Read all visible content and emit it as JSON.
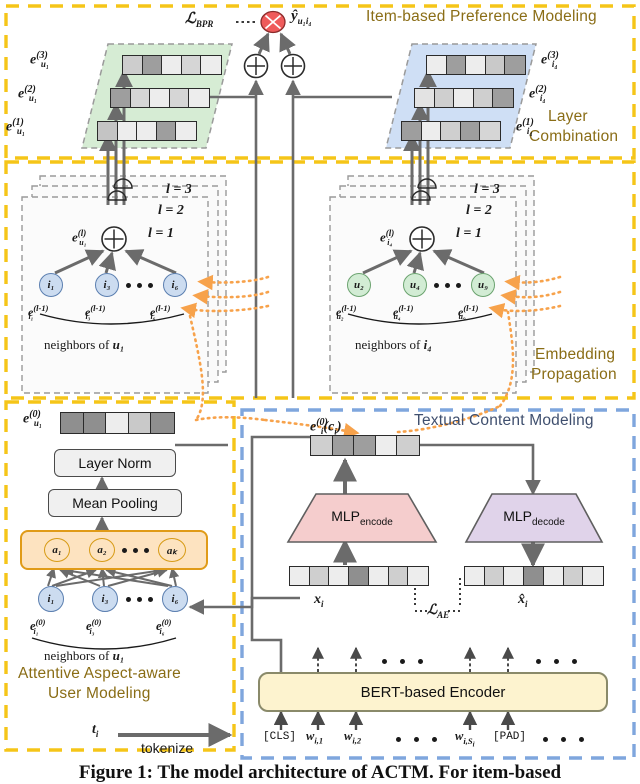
{
  "figure": {
    "caption": "Figure 1: The model architecture of ACTM. For item-based"
  },
  "sections": [
    {
      "id": "item-based-preference-modeling",
      "label": "Item-based Preference Modeling",
      "color": "#8a6d16"
    },
    {
      "id": "layer-combination",
      "label_line1": "Layer",
      "label_line2": "Combination",
      "color": "#8a6d16"
    },
    {
      "id": "embedding-propagation",
      "label_line1": "Embedding",
      "label_line2": "Propagation",
      "color": "#8a6d16"
    },
    {
      "id": "attentive-aspect-aware-user-modeling",
      "label_line1": "Attentive Aspect-aware",
      "label_line2": "User Modeling",
      "color": "#8a6d16"
    },
    {
      "id": "textual-content-modeling",
      "label": "Textual Content Modeling",
      "color": "#3f4f6e"
    }
  ],
  "top": {
    "bpr_loss": "ℒ",
    "bpr_loss_sub": "BPR",
    "prediction": "ŷ",
    "prediction_sub": "u₁i₄",
    "multiply_symbol": "⊗",
    "plus_symbol": "⊕",
    "multiply_color": "#ef5b5b"
  },
  "layer_combination": {
    "user_panel_color": "#d6ecd4",
    "item_panel_color": "#cfdff5",
    "user_labels": [
      {
        "base": "e",
        "sub": "u₁",
        "sup": "(3)"
      },
      {
        "base": "e",
        "sub": "u₁",
        "sup": "(2)"
      },
      {
        "base": "e",
        "sub": "u₁",
        "sup": "(1)"
      }
    ],
    "item_labels": [
      {
        "base": "e",
        "sub": "i₄",
        "sup": "(3)"
      },
      {
        "base": "e",
        "sub": "i₄",
        "sup": "(2)"
      },
      {
        "base": "e",
        "sub": "i₄",
        "sup": "(1)"
      }
    ],
    "user_vectors": [
      [
        "#cdcdcd",
        "#9e9e9e",
        "#ededed",
        "#d6d6d6",
        "#ededed"
      ],
      [
        "#9e9e9e",
        "#d6d6d6",
        "#ededed",
        "#d6d6d6",
        "#ededed"
      ],
      [
        "#c4c4c4",
        "#ededed",
        "#ededed",
        "#9e9e9e",
        "#ededed"
      ]
    ],
    "item_vectors": [
      [
        "#ededed",
        "#9e9e9e",
        "#ededed",
        "#c9c9c9",
        "#9e9e9e"
      ],
      [
        "#e3e3e3",
        "#cfcfcf",
        "#ededed",
        "#cfcfcf",
        "#9e9e9e"
      ],
      [
        "#9e9e9e",
        "#ededed",
        "#cfcfcf",
        "#9e9e9e",
        "#d6d6d6"
      ]
    ]
  },
  "propagation": {
    "user": {
      "layer_tags": [
        "l = 3",
        "l = 2",
        "l = 1"
      ],
      "center": {
        "base": "e",
        "sub": "u₁",
        "sup": "(l)"
      },
      "aggregator": "⊕",
      "neighbor_nodes": [
        "i₁",
        "i₃",
        "i₆"
      ],
      "neighbor_embeddings": [
        {
          "base": "e",
          "sub": "i₁",
          "sup": "(l-1)"
        },
        {
          "base": "e",
          "sub": "i₃",
          "sup": "(l-1)"
        },
        {
          "base": "e",
          "sub": "i₆",
          "sup": "(l-1)"
        }
      ],
      "brace_label": "neighbors of",
      "brace_label_math": "u₁"
    },
    "item": {
      "layer_tags": [
        "l = 3",
        "l = 2",
        "l = 1"
      ],
      "center": {
        "base": "e",
        "sub": "i₄",
        "sup": "(l)"
      },
      "aggregator": "⊕",
      "neighbor_nodes": [
        "u₂",
        "u₄",
        "u₉"
      ],
      "neighbor_embeddings": [
        {
          "base": "e",
          "sub": "u₂",
          "sup": "(l-1)"
        },
        {
          "base": "e",
          "sub": "u₄",
          "sup": "(l-1)"
        },
        {
          "base": "e",
          "sub": "u₉",
          "sup": "(l-1)"
        }
      ],
      "brace_label": "neighbors of",
      "brace_label_math": "i₄"
    }
  },
  "user_modeling": {
    "output_label": {
      "base": "e",
      "sub": "u₁",
      "sup": "(0)"
    },
    "output_vector": [
      "#8f8f8f",
      "#8f8f8f",
      "#ededed",
      "#c9c9c9",
      "#8f8f8f"
    ],
    "blocks": [
      "Layer Norm",
      "Mean Pooling"
    ],
    "aspect_nodes": [
      "a₁",
      "a₂",
      "aₖ"
    ],
    "aspect_box_fill": "#fde3c0",
    "aspect_box_border": "#e09b18",
    "item_nodes": [
      "i₁",
      "i₃",
      "i₆"
    ],
    "item_embeddings": [
      {
        "base": "e",
        "sub": "i₁",
        "sup": "(0)"
      },
      {
        "base": "e",
        "sub": "i₃",
        "sup": "(0)"
      },
      {
        "base": "e",
        "sub": "i₆",
        "sup": "(0)"
      }
    ],
    "brace_label": "neighbors of",
    "brace_label_math": "u₁"
  },
  "textual": {
    "content_label": {
      "base": "e",
      "sub": "i",
      "sup": "(0)",
      "paren": "(c",
      "paren_sub": "i",
      "paren_close": ")"
    },
    "content_vector": [
      "#cfcfcf",
      "#9e9e9e",
      "#9e9e9e",
      "#ededed",
      "#cfcfcf"
    ],
    "encoder_block": {
      "label": "MLP",
      "subscript": "encode",
      "fill": "#f5cdcd",
      "border": "#6e6e6e"
    },
    "decoder_block": {
      "label": "MLP",
      "subscript": "decode",
      "fill": "#e0d3ea",
      "border": "#6e6e6e"
    },
    "input_vector": [
      "#ededed",
      "#cfcfcf",
      "#ededed",
      "#8f8f8f",
      "#ededed",
      "#cfcfcf",
      "#ededed"
    ],
    "output_vector": [
      "#ededed",
      "#cfcfcf",
      "#ededed",
      "#8f8f8f",
      "#ededed",
      "#cfcfcf",
      "#ededed"
    ],
    "input_label": "x",
    "input_label_sub": "i",
    "output_label": "x̂",
    "output_label_sub": "i",
    "ae_loss": "ℒ",
    "ae_loss_sub": "AE",
    "bert_block": {
      "label": "BERT-based Encoder",
      "fill": "#fdf3cf",
      "border": "#8a8a6a"
    },
    "tokens": [
      "[CLS]",
      "w",
      "w",
      "• • •",
      "w",
      "[PAD]",
      "• • •"
    ],
    "token_display": [
      {
        "text": "[CLS]",
        "mono": true
      },
      {
        "text": "w",
        "sub": "i,1",
        "mono": false
      },
      {
        "text": "w",
        "sub": "i,2",
        "mono": false
      },
      {
        "text": "dots",
        "mono": false
      },
      {
        "text": "w",
        "sub": "i,S",
        "sub2": "i",
        "mono": false
      },
      {
        "text": "[PAD]",
        "mono": true
      },
      {
        "text": "dots",
        "mono": false
      }
    ],
    "tokenize_label": "tokenize",
    "text_input_label": "t",
    "text_input_sub": "i"
  },
  "colors": {
    "yellow_dash": "#f5c518",
    "blue_dash": "#7fa6dd",
    "gray_dash": "#9a9a9a",
    "arrow_gray": "#6b6b6b",
    "orange_dotted": "#f7a24b"
  }
}
